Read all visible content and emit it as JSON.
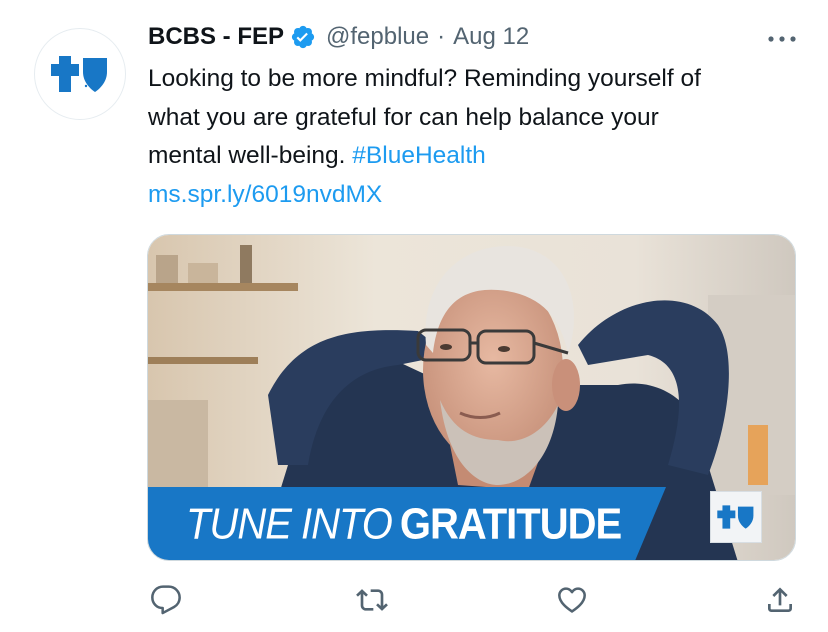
{
  "tweet": {
    "author": {
      "display_name": "BCBS - FEP",
      "handle": "@fepblue",
      "verified": true,
      "avatar_icon": "bcbs-cross-shield-logo"
    },
    "separator": "·",
    "date": "Aug 12",
    "text_lines": [
      "Looking to be more mindful? Reminding yourself of",
      "what you are grateful for can help balance your",
      "mental well-being. "
    ],
    "hashtag": "#BlueHealth",
    "link": "ms.spr.ly/6019nvdMX",
    "media": {
      "banner_light": "TUNE INTO",
      "banner_bold": "GRATITUDE",
      "logo_icon": "bcbs-cross-shield-logo"
    },
    "actions": [
      {
        "name": "reply",
        "icon": "reply-icon"
      },
      {
        "name": "retweet",
        "icon": "retweet-icon"
      },
      {
        "name": "like",
        "icon": "heart-icon"
      },
      {
        "name": "share",
        "icon": "share-icon"
      }
    ]
  },
  "colors": {
    "brand_blue": "#1877c6",
    "link_blue": "#1d9bf0",
    "text": "#0f1419",
    "muted": "#536471"
  }
}
